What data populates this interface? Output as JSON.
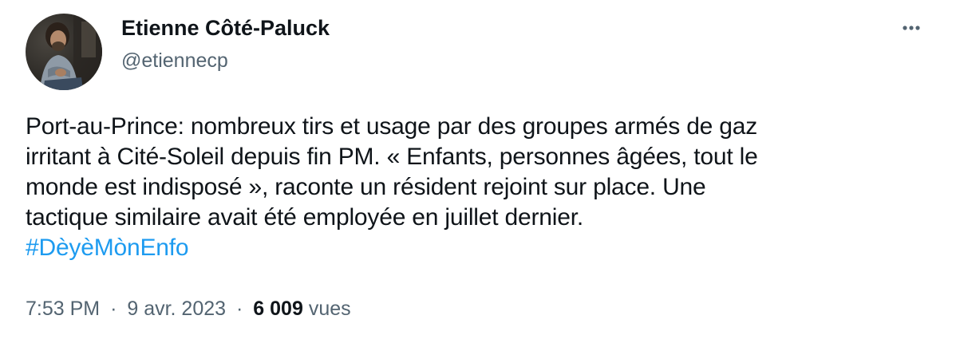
{
  "author": {
    "display_name": "Etienne Côté-Paluck",
    "handle": "@etiennecp"
  },
  "tweet": {
    "lines": [
      "Port-au-Prince: nombreux tirs et usage par des groupes armés de gaz",
      "irritant à Cité-Soleil depuis fin PM. « Enfants, personnes âgées, tout le",
      "monde est indisposé », raconte un résident rejoint sur place. Une",
      "tactique similaire avait été employée en juillet dernier."
    ],
    "hashtag": "#DèyèMònEnfo"
  },
  "meta": {
    "time": "7:53 PM",
    "separator": "·",
    "date": "9 avr. 2023",
    "views_count": "6 009",
    "views_label": "vues"
  },
  "icons": {
    "more": "more-horizontal-icon",
    "avatar": "profile-photo"
  },
  "colors": {
    "text": "#0f1419",
    "secondary": "#536471",
    "link": "#1d9bf0",
    "background": "#ffffff"
  }
}
